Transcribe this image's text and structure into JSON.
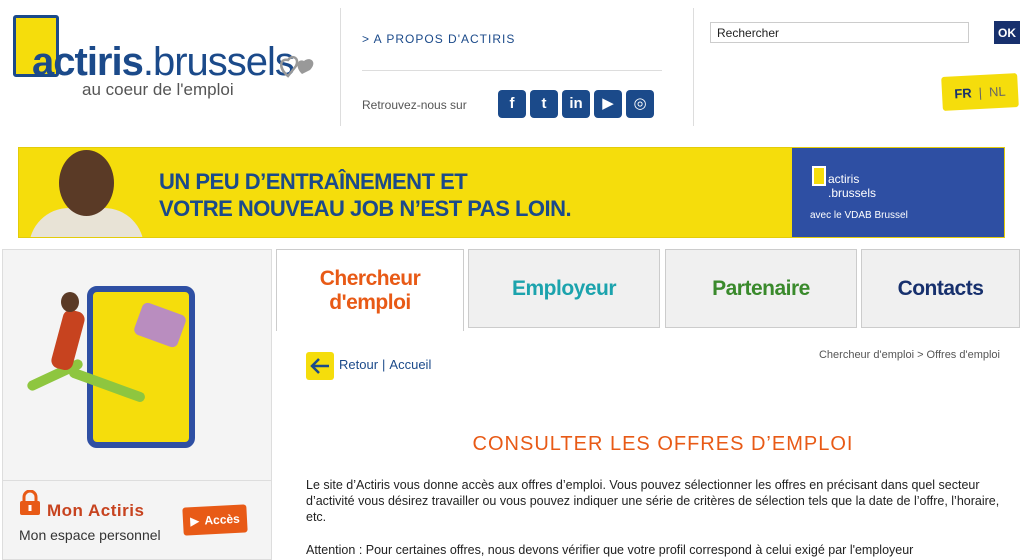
{
  "header": {
    "logo": {
      "name_bold": "actiris",
      "name_rest": ".brussels",
      "tagline": "au coeur de l'emploi"
    },
    "about_link": "> A PROPOS D'ACTIRIS",
    "follow_text": "Retrouvez-nous sur",
    "social": [
      {
        "icon": "facebook-icon",
        "glyph": "f"
      },
      {
        "icon": "twitter-icon",
        "glyph": "t"
      },
      {
        "icon": "linkedin-icon",
        "glyph": "in"
      },
      {
        "icon": "youtube-icon",
        "glyph": "▶"
      },
      {
        "icon": "instagram-icon",
        "glyph": "◎"
      }
    ],
    "search": {
      "placeholder": "Rechercher",
      "button": "OK"
    },
    "lang": {
      "active": "FR",
      "separator": "|",
      "other": "NL"
    }
  },
  "banner": {
    "line1": "UN PEU D’ENTRAÎNEMENT ET",
    "line2": "VOTRE NOUVEAU JOB N’EST PAS LOIN.",
    "logo_line1": "actiris",
    "logo_line2": ".brussels",
    "partner": "avec le VDAB Brussel"
  },
  "sidebar": {
    "account_title": "Mon Actiris",
    "account_subtitle": "Mon espace personnel",
    "access_button": "Accès"
  },
  "tabs": [
    {
      "label": "Chercheur d'emploi",
      "color": "#e85a16",
      "active": true
    },
    {
      "label": "Employeur",
      "color": "#1ca3ad",
      "active": false
    },
    {
      "label": "Partenaire",
      "color": "#3a8a2c",
      "active": false
    },
    {
      "label": "Contacts",
      "color": "#17306d",
      "active": false
    }
  ],
  "main": {
    "back": "Retour",
    "separator": "|",
    "home": "Accueil",
    "breadcrumb": "Chercheur d'emploi > Offres d'emploi",
    "title": "CONSULTER LES OFFRES D’EMPLOI",
    "intro": "Le site d’Actiris vous donne accès aux offres d’emploi. Vous pouvez sélectionner les offres en précisant dans quel secteur d’activité vous désirez travailler ou vous pouvez indiquer une série de critères de sélection tels que la date de l’offre, l’horaire, etc.",
    "attention": "Attention : Pour certaines offres, nous devons vérifier que votre profil correspond à celui exigé par l'employeur"
  },
  "colors": {
    "brand_blue": "#1b4a8a",
    "brand_yellow": "#f5dd0c",
    "accent_orange": "#e85a16"
  }
}
